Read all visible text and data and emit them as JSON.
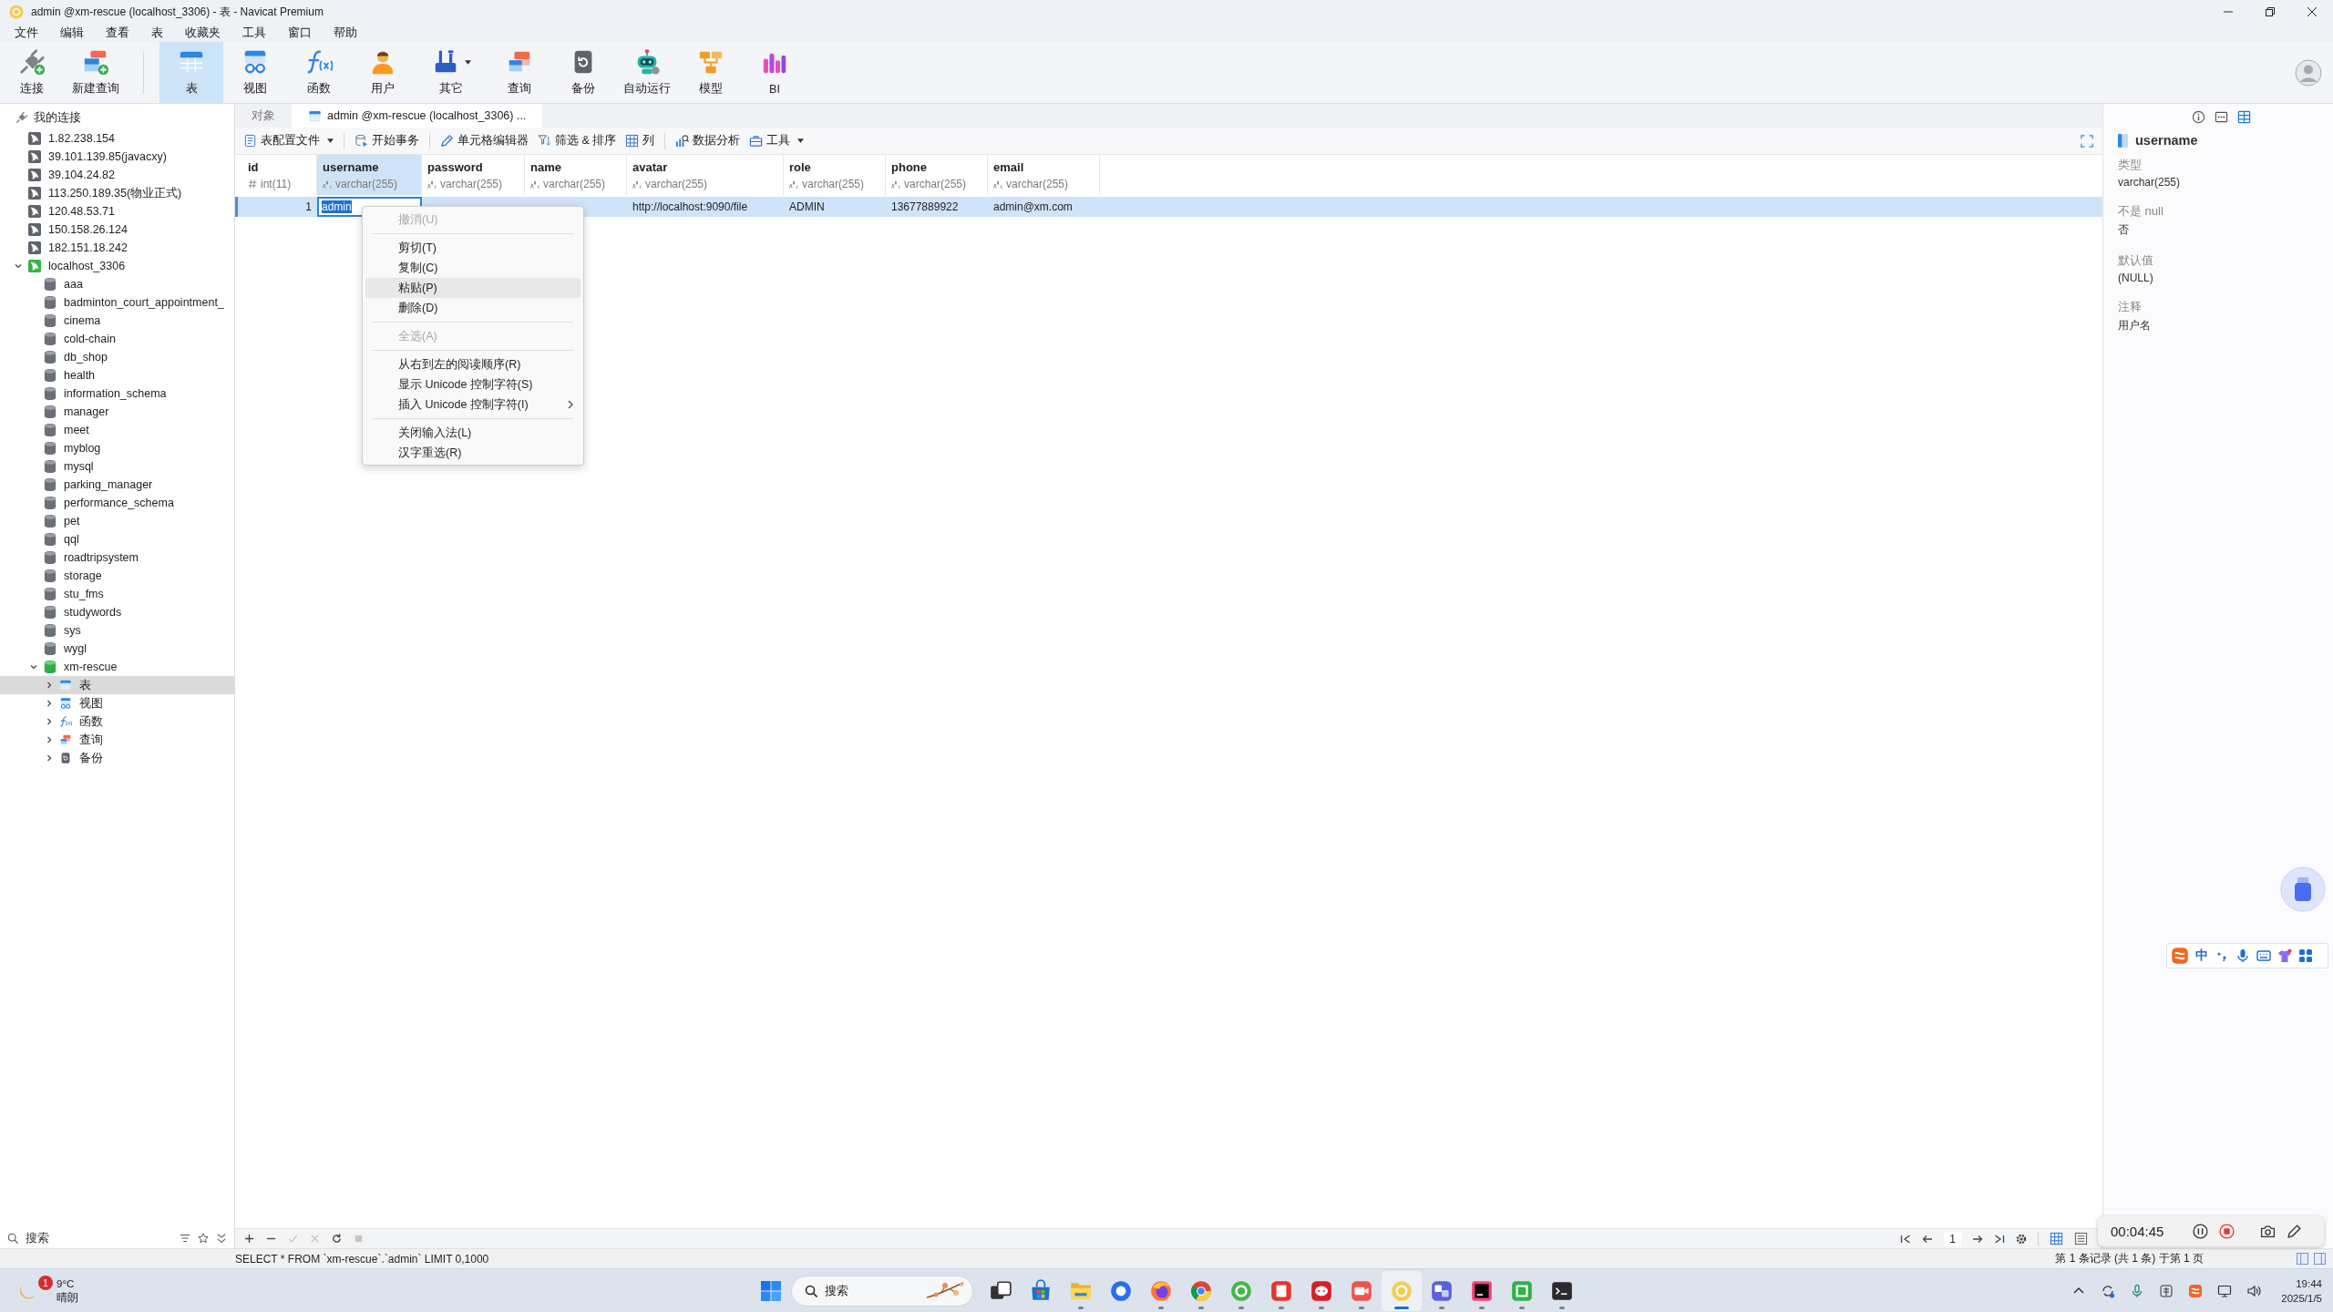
{
  "window": {
    "title": "admin @xm-rescue (localhost_3306) - 表 - Navicat Premium"
  },
  "menu_bar": [
    "文件",
    "编辑",
    "查看",
    "表",
    "收藏夹",
    "工具",
    "窗口",
    "帮助"
  ],
  "toolbar": [
    {
      "label": "连接",
      "selected": false,
      "dropdown": false
    },
    {
      "label": "新建查询",
      "selected": false,
      "dropdown": false
    },
    {
      "label": "表",
      "selected": true,
      "dropdown": false
    },
    {
      "label": "视图",
      "selected": false,
      "dropdown": false
    },
    {
      "label": "函数",
      "selected": false,
      "dropdown": false
    },
    {
      "label": "用户",
      "selected": false,
      "dropdown": false
    },
    {
      "label": "其它",
      "selected": false,
      "dropdown": true
    },
    {
      "label": "查询",
      "selected": false,
      "dropdown": false
    },
    {
      "label": "备份",
      "selected": false,
      "dropdown": false
    },
    {
      "label": "自动运行",
      "selected": false,
      "dropdown": false
    },
    {
      "label": "模型",
      "selected": false,
      "dropdown": false
    },
    {
      "label": "BI",
      "selected": false,
      "dropdown": false
    }
  ],
  "sidebar": {
    "root": "我的连接",
    "tree": [
      {
        "kind": "connection",
        "label": "1.82.238.154",
        "open": false,
        "selected": false
      },
      {
        "kind": "connection",
        "label": "39.101.139.85(javacxy)",
        "open": false,
        "selected": false
      },
      {
        "kind": "connection",
        "label": "39.104.24.82",
        "open": false,
        "selected": false
      },
      {
        "kind": "connection",
        "label": "113.250.189.35(物业正式)",
        "open": false,
        "selected": false
      },
      {
        "kind": "connection",
        "label": "120.48.53.71",
        "open": false,
        "selected": false
      },
      {
        "kind": "connection",
        "label": "150.158.26.124",
        "open": false,
        "selected": false
      },
      {
        "kind": "connection",
        "label": "182.151.18.242",
        "open": false,
        "selected": false
      },
      {
        "kind": "connection",
        "label": "localhost_3306",
        "open": true,
        "expanded": true,
        "selected": false,
        "children": [
          {
            "kind": "database",
            "label": "aaa",
            "open": false,
            "selected": false
          },
          {
            "kind": "database",
            "label": "badminton_court_appointment_",
            "open": false,
            "selected": false
          },
          {
            "kind": "database",
            "label": "cinema",
            "open": false,
            "selected": false
          },
          {
            "kind": "database",
            "label": "cold-chain",
            "open": false,
            "selected": false
          },
          {
            "kind": "database",
            "label": "db_shop",
            "open": false,
            "selected": false
          },
          {
            "kind": "database",
            "label": "health",
            "open": false,
            "selected": false
          },
          {
            "kind": "database",
            "label": "information_schema",
            "open": false,
            "selected": false
          },
          {
            "kind": "database",
            "label": "manager",
            "open": false,
            "selected": false
          },
          {
            "kind": "database",
            "label": "meet",
            "open": false,
            "selected": false
          },
          {
            "kind": "database",
            "label": "myblog",
            "open": false,
            "selected": false
          },
          {
            "kind": "database",
            "label": "mysql",
            "open": false,
            "selected": false
          },
          {
            "kind": "database",
            "label": "parking_manager",
            "open": false,
            "selected": false
          },
          {
            "kind": "database",
            "label": "performance_schema",
            "open": false,
            "selected": false
          },
          {
            "kind": "database",
            "label": "pet",
            "open": false,
            "selected": false
          },
          {
            "kind": "database",
            "label": "qql",
            "open": false,
            "selected": false
          },
          {
            "kind": "database",
            "label": "roadtripsystem",
            "open": false,
            "selected": false
          },
          {
            "kind": "database",
            "label": "storage",
            "open": false,
            "selected": false
          },
          {
            "kind": "database",
            "label": "stu_fms",
            "open": false,
            "selected": false
          },
          {
            "kind": "database",
            "label": "studywords",
            "open": false,
            "selected": false
          },
          {
            "kind": "database",
            "label": "sys",
            "open": false,
            "selected": false
          },
          {
            "kind": "database",
            "label": "wygl",
            "open": false,
            "selected": false
          },
          {
            "kind": "database",
            "label": "xm-rescue",
            "open": true,
            "expanded": true,
            "selected": false,
            "children": [
              {
                "kind": "folder",
                "label": "表",
                "expanded": false,
                "selected": true
              },
              {
                "kind": "folder",
                "label": "视图",
                "expanded": false,
                "selected": false
              },
              {
                "kind": "folder",
                "label": "函数",
                "expanded": false,
                "selected": false
              },
              {
                "kind": "folder",
                "label": "查询",
                "expanded": false,
                "selected": false
              },
              {
                "kind": "folder",
                "label": "备份",
                "expanded": false,
                "selected": false
              }
            ]
          }
        ]
      }
    ],
    "search": {
      "placeholder": "搜索"
    }
  },
  "tabs": [
    {
      "kind": "objects",
      "label": "对象",
      "selected": false
    },
    {
      "kind": "table",
      "label": "admin @xm-rescue (localhost_3306) ...",
      "selected": true
    }
  ],
  "grid_toolbar": [
    {
      "label": "表配置文件",
      "dropdown": true
    },
    {
      "label": "开始事务",
      "dropdown": false
    },
    {
      "label": "单元格编辑器",
      "dropdown": false
    },
    {
      "label": "筛选 & 排序",
      "dropdown": false
    },
    {
      "label": "列",
      "dropdown": false
    },
    {
      "label": "数据分析",
      "dropdown": false
    },
    {
      "label": "工具",
      "dropdown": true
    }
  ],
  "table": {
    "columns": [
      {
        "name": "id",
        "type": "int(11)",
        "kind": "number",
        "selected": false
      },
      {
        "name": "username",
        "type": "varchar(255)",
        "kind": "text",
        "selected": true
      },
      {
        "name": "password",
        "type": "varchar(255)",
        "kind": "text",
        "selected": false
      },
      {
        "name": "name",
        "type": "varchar(255)",
        "kind": "text",
        "selected": false
      },
      {
        "name": "avatar",
        "type": "varchar(255)",
        "kind": "text",
        "selected": false
      },
      {
        "name": "role",
        "type": "varchar(255)",
        "kind": "text",
        "selected": false
      },
      {
        "name": "phone",
        "type": "varchar(255)",
        "kind": "text",
        "selected": false
      },
      {
        "name": "email",
        "type": "varchar(255)",
        "kind": "text",
        "selected": false
      }
    ],
    "rows": [
      {
        "selected": true,
        "cells": [
          {
            "text": "1",
            "editing": false
          },
          {
            "text": "admin",
            "editing": true
          },
          {
            "editing": false
          },
          {
            "editing": false
          },
          {
            "text": "http://localhost:9090/file",
            "editing": false
          },
          {
            "text": "ADMIN",
            "editing": false
          },
          {
            "text": "13677889922",
            "editing": false
          },
          {
            "text": "admin@xm.com",
            "editing": false
          }
        ]
      }
    ]
  },
  "context_menu": {
    "items": [
      {
        "kind": "item",
        "label": "撤消(U)",
        "disabled": true,
        "highlighted": false,
        "submenu": false
      },
      {
        "kind": "separator"
      },
      {
        "kind": "item",
        "label": "剪切(T)",
        "disabled": false,
        "highlighted": false,
        "submenu": false
      },
      {
        "kind": "item",
        "label": "复制(C)",
        "disabled": false,
        "highlighted": false,
        "submenu": false
      },
      {
        "kind": "item",
        "label": "粘贴(P)",
        "disabled": false,
        "highlighted": true,
        "submenu": false
      },
      {
        "kind": "item",
        "label": "删除(D)",
        "disabled": false,
        "highlighted": false,
        "submenu": false
      },
      {
        "kind": "separator"
      },
      {
        "kind": "item",
        "label": "全选(A)",
        "disabled": true,
        "highlighted": false,
        "submenu": false
      },
      {
        "kind": "separator"
      },
      {
        "kind": "item",
        "label": "从右到左的阅读顺序(R)",
        "disabled": false,
        "highlighted": false,
        "submenu": false
      },
      {
        "kind": "item",
        "label": "显示 Unicode 控制字符(S)",
        "disabled": false,
        "highlighted": false,
        "submenu": false
      },
      {
        "kind": "item",
        "label": "插入 Unicode 控制字符(I)",
        "disabled": false,
        "highlighted": false,
        "submenu": true
      },
      {
        "kind": "separator"
      },
      {
        "kind": "item",
        "label": "关闭输入法(L)",
        "disabled": false,
        "highlighted": false,
        "submenu": false
      },
      {
        "kind": "item",
        "label": "汉字重选(R)",
        "disabled": false,
        "highlighted": false,
        "submenu": false
      }
    ]
  },
  "grid_footer": {
    "record_buttons": [
      {
        "disabled": false
      },
      {
        "disabled": false
      },
      {
        "disabled": true
      },
      {
        "disabled": true
      },
      {
        "disabled": false
      },
      {
        "disabled": true
      }
    ],
    "page": "1",
    "views": [
      {
        "selected": true
      },
      {
        "selected": false
      }
    ]
  },
  "field_panel": {
    "views": [
      {
        "selected": false
      },
      {
        "selected": false
      },
      {
        "selected": true
      }
    ],
    "field_name": "username",
    "properties": [
      {
        "label": "类型",
        "value": "varchar(255)"
      },
      {
        "label": "不是 null",
        "value": "否"
      },
      {
        "label": "默认值",
        "value": "(NULL)"
      },
      {
        "label": "注释",
        "value": "用户名"
      }
    ]
  },
  "ime_bar": {
    "mode": "中"
  },
  "recorder": {
    "elapsed": "00:04:45"
  },
  "status_bar": {
    "query": "SELECT * FROM `xm-rescue`.`admin` LIMIT 0,1000",
    "records": "第 1 条记录 (共 1 条) 于第 1 页"
  },
  "taskbar": {
    "weather": {
      "badge": "1",
      "temperature": "9°C",
      "condition": "晴朗"
    },
    "search": {
      "placeholder": "搜索"
    },
    "apps": [
      {
        "running": false,
        "active": false
      },
      {
        "running": false,
        "active": false
      },
      {
        "running": true,
        "active": false
      },
      {
        "running": false,
        "active": false
      },
      {
        "running": true,
        "active": false
      },
      {
        "running": true,
        "active": false
      },
      {
        "running": true,
        "active": false
      },
      {
        "running": true,
        "active": false
      },
      {
        "running": true,
        "active": false
      },
      {
        "running": true,
        "active": false
      },
      {
        "running": true,
        "active": true
      },
      {
        "running": true,
        "active": false
      },
      {
        "running": true,
        "active": false
      },
      {
        "running": true,
        "active": false
      },
      {
        "running": true,
        "active": false
      }
    ],
    "clock": {
      "time": "19:44",
      "date": "2025/1/5"
    }
  }
}
